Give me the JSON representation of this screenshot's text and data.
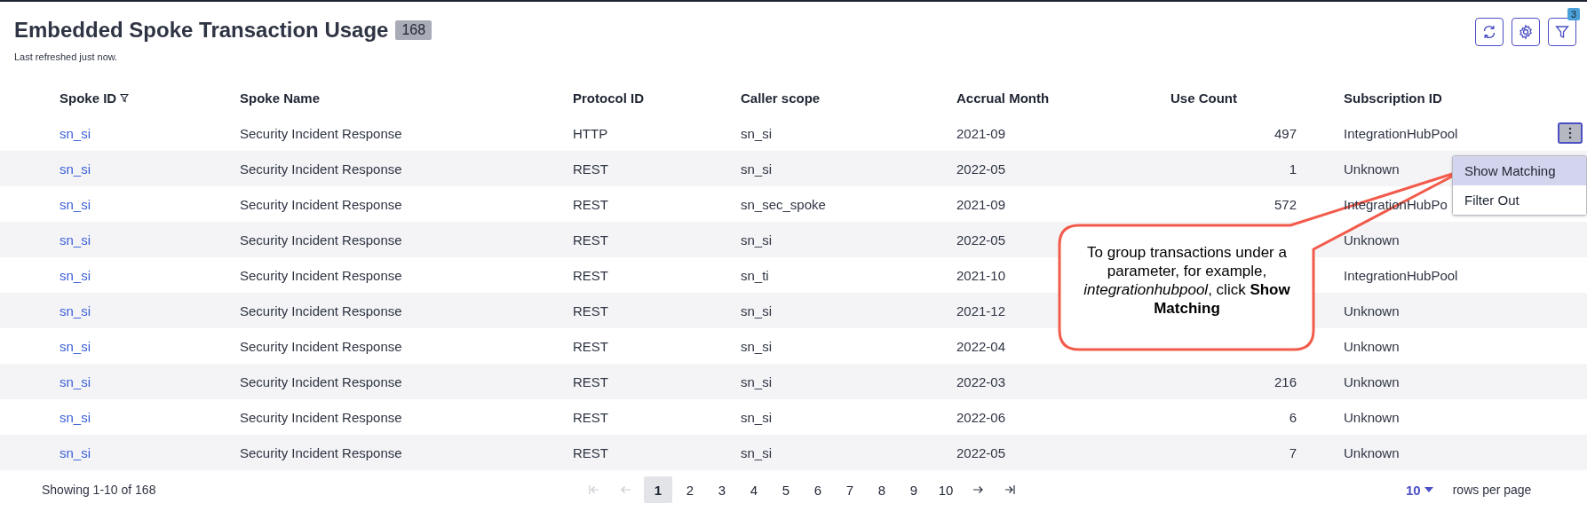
{
  "header": {
    "title": "Embedded Spoke Transaction Usage",
    "count": "168",
    "subtitle": "Last refreshed just now."
  },
  "toolbar": {
    "filter_badge": "3"
  },
  "table": {
    "columns": [
      {
        "label": "Spoke ID",
        "filtered": true
      },
      {
        "label": "Spoke Name",
        "filtered": false
      },
      {
        "label": "Protocol ID",
        "filtered": false
      },
      {
        "label": "Caller scope",
        "filtered": false
      },
      {
        "label": "Accrual Month",
        "filtered": false
      },
      {
        "label": "Use Count",
        "filtered": false
      },
      {
        "label": "Subscription ID",
        "filtered": false
      }
    ],
    "rows": [
      {
        "spoke_id": "sn_si",
        "spoke_name": "Security Incident Response",
        "protocol_id": "HTTP",
        "caller_scope": "sn_si",
        "accrual_month": "2021-09",
        "use_count": "497",
        "subscription_id": "IntegrationHubPool",
        "actions_menu": {
          "items": [
            {
              "label": "Show Matching",
              "selected": true
            },
            {
              "label": "Filter Out",
              "selected": false
            }
          ]
        }
      },
      {
        "spoke_id": "sn_si",
        "spoke_name": "Security Incident Response",
        "protocol_id": "REST",
        "caller_scope": "sn_si",
        "accrual_month": "2022-05",
        "use_count": "1",
        "subscription_id": "Unknown"
      },
      {
        "spoke_id": "sn_si",
        "spoke_name": "Security Incident Response",
        "protocol_id": "REST",
        "caller_scope": "sn_sec_spoke",
        "accrual_month": "2021-09",
        "use_count": "572",
        "subscription_id": "IntegrationHubPo"
      },
      {
        "spoke_id": "sn_si",
        "spoke_name": "Security Incident Response",
        "protocol_id": "REST",
        "caller_scope": "sn_si",
        "accrual_month": "2022-05",
        "subscription_id": "Unknown"
      },
      {
        "spoke_id": "sn_si",
        "spoke_name": "Security Incident Response",
        "protocol_id": "REST",
        "caller_scope": "sn_ti",
        "accrual_month": "2021-10",
        "subscription_id": "IntegrationHubPool"
      },
      {
        "spoke_id": "sn_si",
        "spoke_name": "Security Incident Response",
        "protocol_id": "REST",
        "caller_scope": "sn_si",
        "accrual_month": "2021-12",
        "subscription_id": "Unknown"
      },
      {
        "spoke_id": "sn_si",
        "spoke_name": "Security Incident Response",
        "protocol_id": "REST",
        "caller_scope": "sn_si",
        "accrual_month": "2022-04",
        "subscription_id": "Unknown"
      },
      {
        "spoke_id": "sn_si",
        "spoke_name": "Security Incident Response",
        "protocol_id": "REST",
        "caller_scope": "sn_si",
        "accrual_month": "2022-03",
        "use_count": "216",
        "subscription_id": "Unknown"
      },
      {
        "spoke_id": "sn_si",
        "spoke_name": "Security Incident Response",
        "protocol_id": "REST",
        "caller_scope": "sn_si",
        "accrual_month": "2022-06",
        "use_count": "6",
        "subscription_id": "Unknown"
      },
      {
        "spoke_id": "sn_si",
        "spoke_name": "Security Incident Response",
        "protocol_id": "REST",
        "caller_scope": "sn_si",
        "accrual_month": "2022-05",
        "use_count": "7",
        "subscription_id": "Unknown"
      }
    ]
  },
  "pagination": {
    "summary": "Showing 1-10 of 168",
    "nav_before": [
      {
        "kind": "first",
        "disabled": true
      },
      {
        "kind": "prev",
        "disabled": true
      }
    ],
    "pages": [
      {
        "label": "1",
        "selected": true
      },
      {
        "label": "2",
        "selected": false
      },
      {
        "label": "3",
        "selected": false
      },
      {
        "label": "4",
        "selected": false
      },
      {
        "label": "5",
        "selected": false
      },
      {
        "label": "6",
        "selected": false
      },
      {
        "label": "7",
        "selected": false
      },
      {
        "label": "8",
        "selected": false
      },
      {
        "label": "9",
        "selected": false
      },
      {
        "label": "10",
        "selected": false
      }
    ],
    "nav_after": [
      {
        "kind": "next",
        "disabled": false
      },
      {
        "kind": "last",
        "disabled": false
      }
    ],
    "rows_per_page": "10",
    "rows_per_page_label": "rows per page"
  },
  "callout": {
    "text": "To group transactions under a parameter, for example, *integrationhubpool*, click **Show Matching**"
  }
}
